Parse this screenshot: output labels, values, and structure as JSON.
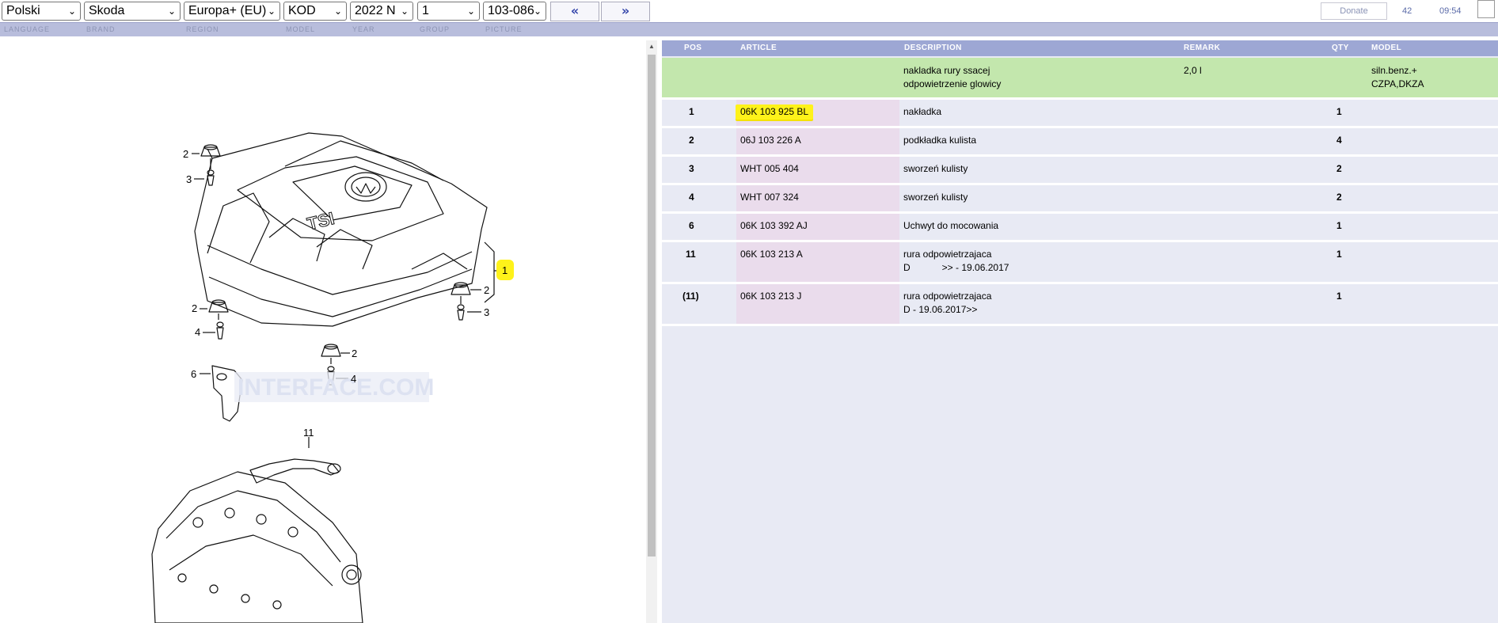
{
  "selectors": {
    "language": "Polski",
    "brand": "Skoda",
    "region": "Europa+ (EU)",
    "model": "KOD",
    "year": "2022  N",
    "group": "1",
    "picture": "103-086"
  },
  "nav": {
    "prev": "«",
    "next": "»"
  },
  "donate_label": "Donate",
  "counter": "42",
  "time": "09:54",
  "labels": {
    "language": "LANGUAGE",
    "brand": "BRAND",
    "region": "REGION",
    "model": "MODEL",
    "year": "YEAR",
    "group": "GROUP",
    "picture": "PICTURE"
  },
  "drawing": {
    "callouts": [
      "2",
      "3",
      "1",
      "2",
      "3",
      "2",
      "4",
      "2",
      "4",
      "6",
      "11"
    ],
    "tsi_text": "TSI",
    "watermark": "INTERFACE.COM"
  },
  "table": {
    "headers": {
      "pos": "POS",
      "article": "ARTICLE",
      "description": "DESCRIPTION",
      "remark": "REMARK",
      "qty": "QTY",
      "model": "MODEL"
    },
    "info_row": {
      "description_line1": "nakladka rury ssacej",
      "description_line2": "odpowietrzenie glowicy",
      "remark": "2,0 l",
      "model_line1": "siln.benz.+",
      "model_line2": "CZPA,DKZA"
    },
    "rows": [
      {
        "pos": "1",
        "article": "06K 103 925 BL",
        "desc1": "nakładka",
        "desc2": "",
        "qty": "1"
      },
      {
        "pos": "2",
        "article": "06J 103 226 A",
        "desc1": "podkładka kulista",
        "desc2": "",
        "qty": "4"
      },
      {
        "pos": "3",
        "article": "WHT 005 404",
        "desc1": "sworzeń kulisty",
        "desc2": "",
        "qty": "2"
      },
      {
        "pos": "4",
        "article": "WHT 007 324",
        "desc1": "sworzeń kulisty",
        "desc2": "",
        "qty": "2"
      },
      {
        "pos": "6",
        "article": "06K 103 392 AJ",
        "desc1": "Uchwyt do mocowania",
        "desc2": "",
        "qty": "1"
      },
      {
        "pos": "11",
        "article": "06K 103 213 A",
        "desc1": "rura odpowietrzajaca",
        "desc2": "D            >> - 19.06.2017",
        "qty": "1"
      },
      {
        "pos": "(11)",
        "article": "06K 103 213 J",
        "desc1": "rura odpowietrzajaca",
        "desc2": "D - 19.06.2017>>",
        "qty": "1"
      }
    ]
  },
  "colors": {
    "header_bg": "#9da7d4",
    "label_bar_bg": "#b8bddc",
    "info_row_bg": "#c3e7ad",
    "row_bg": "#e8eaf4",
    "article_cell_bg": "#eadcec",
    "highlight": "#fef21a"
  }
}
